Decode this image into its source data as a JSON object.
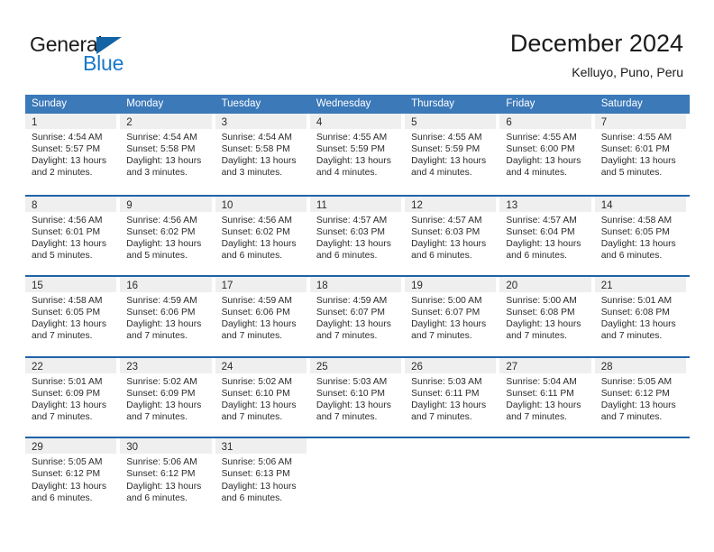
{
  "brand": {
    "name_part1": "General",
    "name_part2": "Blue",
    "logo_icon": "triangle-logo-icon",
    "accent_color": "#1878c8",
    "triangle_color": "#1464a5"
  },
  "header": {
    "title": "December 2024",
    "location": "Kelluyo, Puno, Peru"
  },
  "theme": {
    "header_blue": "#3b79b9",
    "rule_blue": "#1f64a8",
    "daynum_band": "#efefef",
    "text": "#2b2b2b"
  },
  "weekday_headers": [
    "Sunday",
    "Monday",
    "Tuesday",
    "Wednesday",
    "Thursday",
    "Friday",
    "Saturday"
  ],
  "weeks": [
    [
      {
        "day": "1",
        "sunrise": "Sunrise: 4:54 AM",
        "sunset": "Sunset: 5:57 PM",
        "daylight1": "Daylight: 13 hours",
        "daylight2": "and 2 minutes."
      },
      {
        "day": "2",
        "sunrise": "Sunrise: 4:54 AM",
        "sunset": "Sunset: 5:58 PM",
        "daylight1": "Daylight: 13 hours",
        "daylight2": "and 3 minutes."
      },
      {
        "day": "3",
        "sunrise": "Sunrise: 4:54 AM",
        "sunset": "Sunset: 5:58 PM",
        "daylight1": "Daylight: 13 hours",
        "daylight2": "and 3 minutes."
      },
      {
        "day": "4",
        "sunrise": "Sunrise: 4:55 AM",
        "sunset": "Sunset: 5:59 PM",
        "daylight1": "Daylight: 13 hours",
        "daylight2": "and 4 minutes."
      },
      {
        "day": "5",
        "sunrise": "Sunrise: 4:55 AM",
        "sunset": "Sunset: 5:59 PM",
        "daylight1": "Daylight: 13 hours",
        "daylight2": "and 4 minutes."
      },
      {
        "day": "6",
        "sunrise": "Sunrise: 4:55 AM",
        "sunset": "Sunset: 6:00 PM",
        "daylight1": "Daylight: 13 hours",
        "daylight2": "and 4 minutes."
      },
      {
        "day": "7",
        "sunrise": "Sunrise: 4:55 AM",
        "sunset": "Sunset: 6:01 PM",
        "daylight1": "Daylight: 13 hours",
        "daylight2": "and 5 minutes."
      }
    ],
    [
      {
        "day": "8",
        "sunrise": "Sunrise: 4:56 AM",
        "sunset": "Sunset: 6:01 PM",
        "daylight1": "Daylight: 13 hours",
        "daylight2": "and 5 minutes."
      },
      {
        "day": "9",
        "sunrise": "Sunrise: 4:56 AM",
        "sunset": "Sunset: 6:02 PM",
        "daylight1": "Daylight: 13 hours",
        "daylight2": "and 5 minutes."
      },
      {
        "day": "10",
        "sunrise": "Sunrise: 4:56 AM",
        "sunset": "Sunset: 6:02 PM",
        "daylight1": "Daylight: 13 hours",
        "daylight2": "and 6 minutes."
      },
      {
        "day": "11",
        "sunrise": "Sunrise: 4:57 AM",
        "sunset": "Sunset: 6:03 PM",
        "daylight1": "Daylight: 13 hours",
        "daylight2": "and 6 minutes."
      },
      {
        "day": "12",
        "sunrise": "Sunrise: 4:57 AM",
        "sunset": "Sunset: 6:03 PM",
        "daylight1": "Daylight: 13 hours",
        "daylight2": "and 6 minutes."
      },
      {
        "day": "13",
        "sunrise": "Sunrise: 4:57 AM",
        "sunset": "Sunset: 6:04 PM",
        "daylight1": "Daylight: 13 hours",
        "daylight2": "and 6 minutes."
      },
      {
        "day": "14",
        "sunrise": "Sunrise: 4:58 AM",
        "sunset": "Sunset: 6:05 PM",
        "daylight1": "Daylight: 13 hours",
        "daylight2": "and 6 minutes."
      }
    ],
    [
      {
        "day": "15",
        "sunrise": "Sunrise: 4:58 AM",
        "sunset": "Sunset: 6:05 PM",
        "daylight1": "Daylight: 13 hours",
        "daylight2": "and 7 minutes."
      },
      {
        "day": "16",
        "sunrise": "Sunrise: 4:59 AM",
        "sunset": "Sunset: 6:06 PM",
        "daylight1": "Daylight: 13 hours",
        "daylight2": "and 7 minutes."
      },
      {
        "day": "17",
        "sunrise": "Sunrise: 4:59 AM",
        "sunset": "Sunset: 6:06 PM",
        "daylight1": "Daylight: 13 hours",
        "daylight2": "and 7 minutes."
      },
      {
        "day": "18",
        "sunrise": "Sunrise: 4:59 AM",
        "sunset": "Sunset: 6:07 PM",
        "daylight1": "Daylight: 13 hours",
        "daylight2": "and 7 minutes."
      },
      {
        "day": "19",
        "sunrise": "Sunrise: 5:00 AM",
        "sunset": "Sunset: 6:07 PM",
        "daylight1": "Daylight: 13 hours",
        "daylight2": "and 7 minutes."
      },
      {
        "day": "20",
        "sunrise": "Sunrise: 5:00 AM",
        "sunset": "Sunset: 6:08 PM",
        "daylight1": "Daylight: 13 hours",
        "daylight2": "and 7 minutes."
      },
      {
        "day": "21",
        "sunrise": "Sunrise: 5:01 AM",
        "sunset": "Sunset: 6:08 PM",
        "daylight1": "Daylight: 13 hours",
        "daylight2": "and 7 minutes."
      }
    ],
    [
      {
        "day": "22",
        "sunrise": "Sunrise: 5:01 AM",
        "sunset": "Sunset: 6:09 PM",
        "daylight1": "Daylight: 13 hours",
        "daylight2": "and 7 minutes."
      },
      {
        "day": "23",
        "sunrise": "Sunrise: 5:02 AM",
        "sunset": "Sunset: 6:09 PM",
        "daylight1": "Daylight: 13 hours",
        "daylight2": "and 7 minutes."
      },
      {
        "day": "24",
        "sunrise": "Sunrise: 5:02 AM",
        "sunset": "Sunset: 6:10 PM",
        "daylight1": "Daylight: 13 hours",
        "daylight2": "and 7 minutes."
      },
      {
        "day": "25",
        "sunrise": "Sunrise: 5:03 AM",
        "sunset": "Sunset: 6:10 PM",
        "daylight1": "Daylight: 13 hours",
        "daylight2": "and 7 minutes."
      },
      {
        "day": "26",
        "sunrise": "Sunrise: 5:03 AM",
        "sunset": "Sunset: 6:11 PM",
        "daylight1": "Daylight: 13 hours",
        "daylight2": "and 7 minutes."
      },
      {
        "day": "27",
        "sunrise": "Sunrise: 5:04 AM",
        "sunset": "Sunset: 6:11 PM",
        "daylight1": "Daylight: 13 hours",
        "daylight2": "and 7 minutes."
      },
      {
        "day": "28",
        "sunrise": "Sunrise: 5:05 AM",
        "sunset": "Sunset: 6:12 PM",
        "daylight1": "Daylight: 13 hours",
        "daylight2": "and 7 minutes."
      }
    ],
    [
      {
        "day": "29",
        "sunrise": "Sunrise: 5:05 AM",
        "sunset": "Sunset: 6:12 PM",
        "daylight1": "Daylight: 13 hours",
        "daylight2": "and 6 minutes."
      },
      {
        "day": "30",
        "sunrise": "Sunrise: 5:06 AM",
        "sunset": "Sunset: 6:12 PM",
        "daylight1": "Daylight: 13 hours",
        "daylight2": "and 6 minutes."
      },
      {
        "day": "31",
        "sunrise": "Sunrise: 5:06 AM",
        "sunset": "Sunset: 6:13 PM",
        "daylight1": "Daylight: 13 hours",
        "daylight2": "and 6 minutes."
      },
      {
        "day": "",
        "sunrise": "",
        "sunset": "",
        "daylight1": "",
        "daylight2": ""
      },
      {
        "day": "",
        "sunrise": "",
        "sunset": "",
        "daylight1": "",
        "daylight2": ""
      },
      {
        "day": "",
        "sunrise": "",
        "sunset": "",
        "daylight1": "",
        "daylight2": ""
      },
      {
        "day": "",
        "sunrise": "",
        "sunset": "",
        "daylight1": "",
        "daylight2": ""
      }
    ]
  ]
}
